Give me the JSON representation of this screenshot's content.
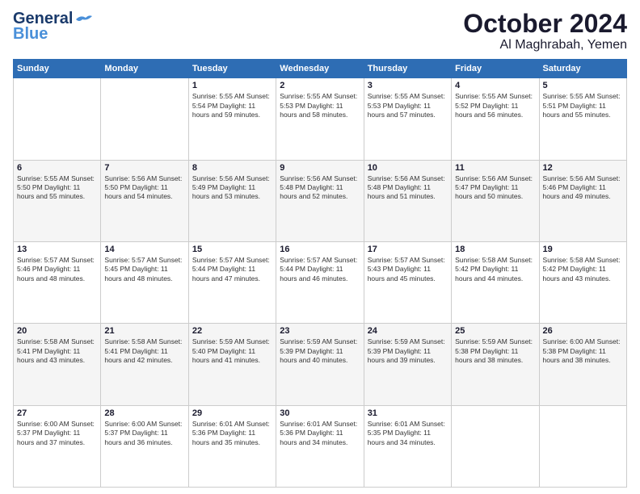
{
  "logo": {
    "line1": "General",
    "line2": "Blue"
  },
  "title": "October 2024",
  "subtitle": "Al Maghrabah, Yemen",
  "weekdays": [
    "Sunday",
    "Monday",
    "Tuesday",
    "Wednesday",
    "Thursday",
    "Friday",
    "Saturday"
  ],
  "weeks": [
    [
      {
        "day": "",
        "content": ""
      },
      {
        "day": "",
        "content": ""
      },
      {
        "day": "1",
        "content": "Sunrise: 5:55 AM\nSunset: 5:54 PM\nDaylight: 11 hours\nand 59 minutes."
      },
      {
        "day": "2",
        "content": "Sunrise: 5:55 AM\nSunset: 5:53 PM\nDaylight: 11 hours\nand 58 minutes."
      },
      {
        "day": "3",
        "content": "Sunrise: 5:55 AM\nSunset: 5:53 PM\nDaylight: 11 hours\nand 57 minutes."
      },
      {
        "day": "4",
        "content": "Sunrise: 5:55 AM\nSunset: 5:52 PM\nDaylight: 11 hours\nand 56 minutes."
      },
      {
        "day": "5",
        "content": "Sunrise: 5:55 AM\nSunset: 5:51 PM\nDaylight: 11 hours\nand 55 minutes."
      }
    ],
    [
      {
        "day": "6",
        "content": "Sunrise: 5:55 AM\nSunset: 5:50 PM\nDaylight: 11 hours\nand 55 minutes."
      },
      {
        "day": "7",
        "content": "Sunrise: 5:56 AM\nSunset: 5:50 PM\nDaylight: 11 hours\nand 54 minutes."
      },
      {
        "day": "8",
        "content": "Sunrise: 5:56 AM\nSunset: 5:49 PM\nDaylight: 11 hours\nand 53 minutes."
      },
      {
        "day": "9",
        "content": "Sunrise: 5:56 AM\nSunset: 5:48 PM\nDaylight: 11 hours\nand 52 minutes."
      },
      {
        "day": "10",
        "content": "Sunrise: 5:56 AM\nSunset: 5:48 PM\nDaylight: 11 hours\nand 51 minutes."
      },
      {
        "day": "11",
        "content": "Sunrise: 5:56 AM\nSunset: 5:47 PM\nDaylight: 11 hours\nand 50 minutes."
      },
      {
        "day": "12",
        "content": "Sunrise: 5:56 AM\nSunset: 5:46 PM\nDaylight: 11 hours\nand 49 minutes."
      }
    ],
    [
      {
        "day": "13",
        "content": "Sunrise: 5:57 AM\nSunset: 5:46 PM\nDaylight: 11 hours\nand 48 minutes."
      },
      {
        "day": "14",
        "content": "Sunrise: 5:57 AM\nSunset: 5:45 PM\nDaylight: 11 hours\nand 48 minutes."
      },
      {
        "day": "15",
        "content": "Sunrise: 5:57 AM\nSunset: 5:44 PM\nDaylight: 11 hours\nand 47 minutes."
      },
      {
        "day": "16",
        "content": "Sunrise: 5:57 AM\nSunset: 5:44 PM\nDaylight: 11 hours\nand 46 minutes."
      },
      {
        "day": "17",
        "content": "Sunrise: 5:57 AM\nSunset: 5:43 PM\nDaylight: 11 hours\nand 45 minutes."
      },
      {
        "day": "18",
        "content": "Sunrise: 5:58 AM\nSunset: 5:42 PM\nDaylight: 11 hours\nand 44 minutes."
      },
      {
        "day": "19",
        "content": "Sunrise: 5:58 AM\nSunset: 5:42 PM\nDaylight: 11 hours\nand 43 minutes."
      }
    ],
    [
      {
        "day": "20",
        "content": "Sunrise: 5:58 AM\nSunset: 5:41 PM\nDaylight: 11 hours\nand 43 minutes."
      },
      {
        "day": "21",
        "content": "Sunrise: 5:58 AM\nSunset: 5:41 PM\nDaylight: 11 hours\nand 42 minutes."
      },
      {
        "day": "22",
        "content": "Sunrise: 5:59 AM\nSunset: 5:40 PM\nDaylight: 11 hours\nand 41 minutes."
      },
      {
        "day": "23",
        "content": "Sunrise: 5:59 AM\nSunset: 5:39 PM\nDaylight: 11 hours\nand 40 minutes."
      },
      {
        "day": "24",
        "content": "Sunrise: 5:59 AM\nSunset: 5:39 PM\nDaylight: 11 hours\nand 39 minutes."
      },
      {
        "day": "25",
        "content": "Sunrise: 5:59 AM\nSunset: 5:38 PM\nDaylight: 11 hours\nand 38 minutes."
      },
      {
        "day": "26",
        "content": "Sunrise: 6:00 AM\nSunset: 5:38 PM\nDaylight: 11 hours\nand 38 minutes."
      }
    ],
    [
      {
        "day": "27",
        "content": "Sunrise: 6:00 AM\nSunset: 5:37 PM\nDaylight: 11 hours\nand 37 minutes."
      },
      {
        "day": "28",
        "content": "Sunrise: 6:00 AM\nSunset: 5:37 PM\nDaylight: 11 hours\nand 36 minutes."
      },
      {
        "day": "29",
        "content": "Sunrise: 6:01 AM\nSunset: 5:36 PM\nDaylight: 11 hours\nand 35 minutes."
      },
      {
        "day": "30",
        "content": "Sunrise: 6:01 AM\nSunset: 5:36 PM\nDaylight: 11 hours\nand 34 minutes."
      },
      {
        "day": "31",
        "content": "Sunrise: 6:01 AM\nSunset: 5:35 PM\nDaylight: 11 hours\nand 34 minutes."
      },
      {
        "day": "",
        "content": ""
      },
      {
        "day": "",
        "content": ""
      }
    ]
  ]
}
